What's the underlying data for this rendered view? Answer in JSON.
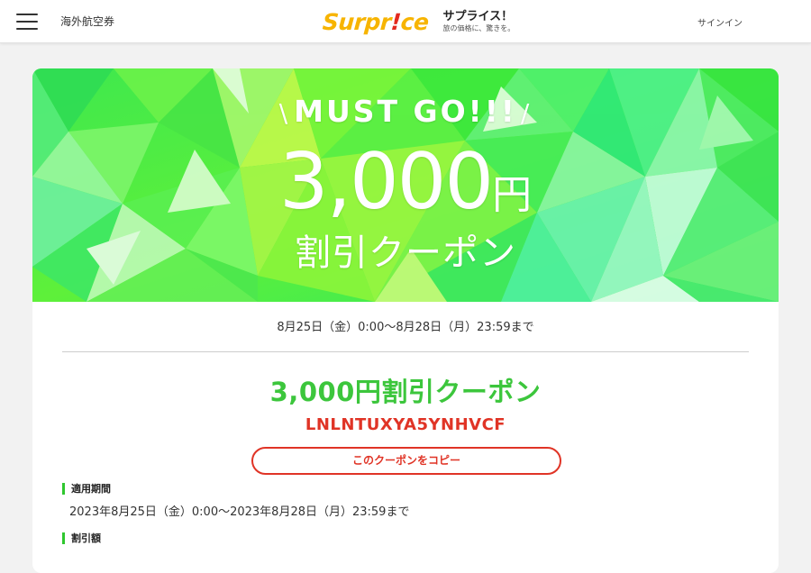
{
  "header": {
    "nav_link": "海外航空券",
    "logo_main": "Surpr",
    "logo_excl": "!",
    "logo_end": "ce",
    "brand_name": "サプライス！",
    "tagline": "旅の価格に、驚きを。",
    "signin": "サインイン"
  },
  "banner": {
    "slash_left": "\\",
    "headline": "MUST GO!!!",
    "slash_right": "/",
    "amount": "3,000",
    "yen": "円",
    "subtitle": "割引クーポン"
  },
  "coupon": {
    "period": "8月25日（金）0:00〜8月28日（月）23:59まで",
    "title": "3,000円割引クーポン",
    "code": "LNLNTUXYA5YNHVCF",
    "copy_label": "このクーポンをコピー",
    "validity_label": "適用期間",
    "validity_value": "2023年8月25日（金）0:00〜2023年8月28日（月）23:59まで",
    "discount_label": "割引額"
  },
  "colors": {
    "accent_green": "#3cc63c",
    "code_red": "#e03426",
    "logo_yellow": "#f7b400"
  }
}
